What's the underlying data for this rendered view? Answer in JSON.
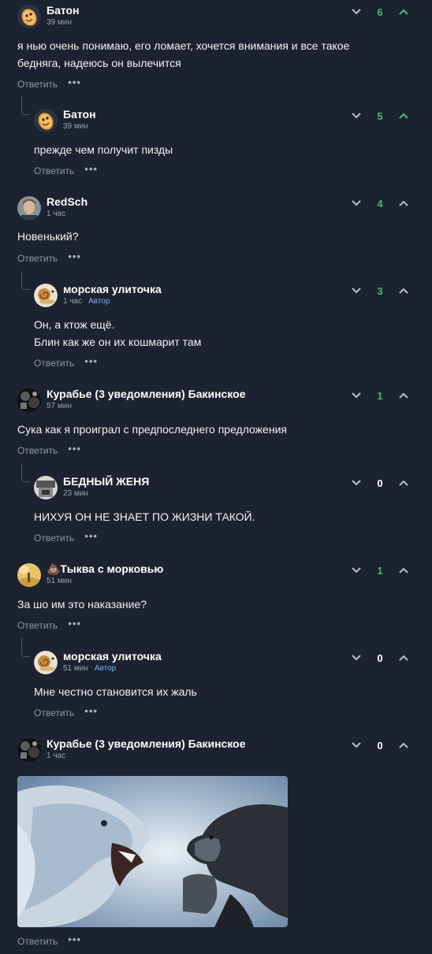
{
  "reply_label": "Ответить",
  "more_label": "•••",
  "colors": {
    "background": "#1c2230",
    "positive": "#3fbf6a",
    "neutral": "#ffffff",
    "arrow": "#b9c0cc",
    "arrow_active": "#3fbf6a",
    "author_badge": "#7ab0f0"
  },
  "comments": [
    {
      "author": "Батон",
      "time": "39 мин",
      "badge": "",
      "score": "6",
      "lines": [
        "я нью очень понимаю, его ломает, хочется внимания и все такое",
        "бедняга, надеюсь он вылечится"
      ],
      "avatar_icon": "baton-icon"
    },
    {
      "author": "Батон",
      "time": "39 мин",
      "badge": "",
      "score": "5",
      "lines": [
        "прежде чем получит пизды"
      ],
      "avatar_icon": "baton-icon"
    },
    {
      "author": "RedSch",
      "time": "1 час",
      "badge": "",
      "score": "4",
      "lines": [
        "Новенький?"
      ],
      "avatar_icon": "person-photo-icon"
    },
    {
      "author": "морская улиточка",
      "time": "1 час",
      "badge": "Автор",
      "score": "3",
      "lines": [
        "Он, а ктож ещё.",
        "Блин как же он их кошмарит там"
      ],
      "avatar_icon": "snail-icon"
    },
    {
      "author": "Курабье (3 уведомления) Бакинское",
      "time": "57 мин",
      "badge": "",
      "score": "1",
      "lines": [
        "Сука как я проиграл с предпоследнего предложения"
      ],
      "avatar_icon": "dark-collage-icon"
    },
    {
      "author": "БЕДНЫЙ ЖЕНЯ",
      "time": "23 мин",
      "badge": "",
      "score": "0",
      "lines": [
        "НИХУЯ ОН НЕ ЗНАЕТ ПО ЖИЗНИ ТАКОЙ."
      ],
      "avatar_icon": "bw-photo-icon"
    },
    {
      "author": "💩Тыква с морковью",
      "time": "51 мин",
      "badge": "",
      "score": "1",
      "lines": [
        "За шо им это наказание?"
      ],
      "avatar_icon": "autumn-photo-icon"
    },
    {
      "author": "морская улиточка",
      "time": "51 мин",
      "badge": "Автор",
      "score": "0",
      "lines": [
        "Мне честно становится их жаль"
      ],
      "avatar_icon": "snail-icon"
    },
    {
      "author": "Курабье (3 уведомления) Бакинское",
      "time": "1 час",
      "badge": "",
      "score": "0",
      "lines": [],
      "avatar_icon": "dark-collage-icon",
      "image_alt": "lion-vs-chimpanzee-image"
    }
  ]
}
